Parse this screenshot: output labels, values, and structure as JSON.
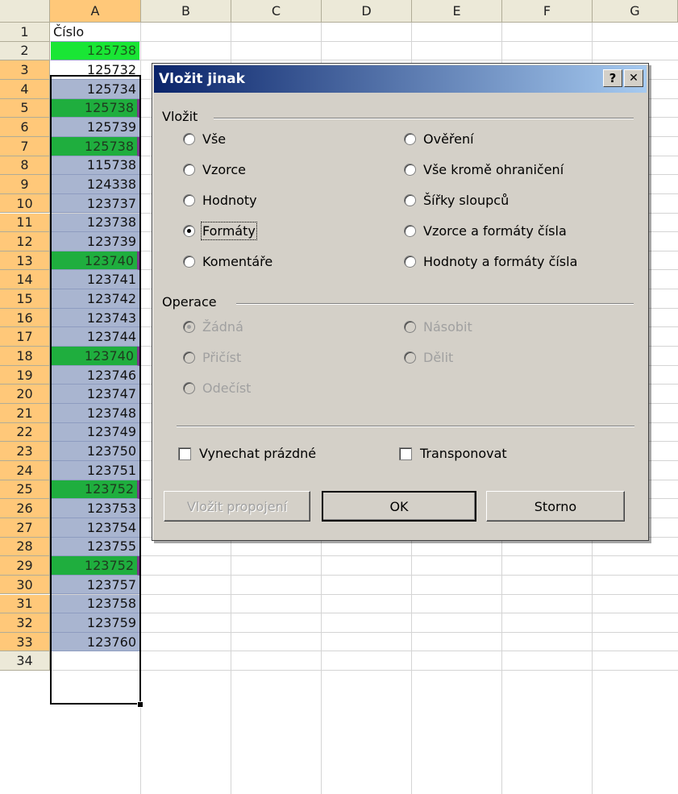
{
  "sheet": {
    "columns": [
      "A",
      "B",
      "C",
      "D",
      "E",
      "F",
      "G"
    ],
    "rows": [
      "1",
      "2",
      "3",
      "4",
      "5",
      "6",
      "7",
      "8",
      "9",
      "10",
      "11",
      "12",
      "13",
      "14",
      "15",
      "16",
      "17",
      "18",
      "19",
      "20",
      "21",
      "22",
      "23",
      "24",
      "25",
      "26",
      "27",
      "28",
      "29",
      "30",
      "31",
      "32",
      "33",
      "34"
    ],
    "column_a": [
      "Číslo",
      "125738",
      "125732",
      "125734",
      "125738",
      "125739",
      "125738",
      "115738",
      "124338",
      "123737",
      "123738",
      "123739",
      "123740",
      "123741",
      "123742",
      "123743",
      "123744",
      "123740",
      "123746",
      "123747",
      "123748",
      "123749",
      "123750",
      "123751",
      "123752",
      "123753",
      "123754",
      "123755",
      "123752",
      "123757",
      "123758",
      "123759",
      "123760"
    ],
    "highlight_colors": {
      "selected": "#a9b5d0",
      "duplicate": "#1fae3e",
      "active": "#19e635"
    }
  },
  "dialog": {
    "title": "Vložit jinak",
    "help_btn": "?",
    "close_btn": "✕",
    "paste_group": "Vložit",
    "paste_left": [
      "Vše",
      "Vzorce",
      "Hodnoty",
      "Formáty",
      "Komentáře"
    ],
    "paste_right": [
      "Ověření",
      "Vše kromě ohraničení",
      "Šířky sloupců",
      "Vzorce a formáty čísla",
      "Hodnoty a formáty čísla"
    ],
    "paste_selected": "Formáty",
    "operation_group": "Operace",
    "op_left": [
      "Žádná",
      "Přičíst",
      "Odečíst"
    ],
    "op_right": [
      "Násobit",
      "Dělit"
    ],
    "op_selected": "Žádná",
    "skip_blanks": "Vynechat prázdné",
    "transpose": "Transponovat",
    "paste_link": "Vložit propojení",
    "ok": "OK",
    "cancel": "Storno"
  }
}
